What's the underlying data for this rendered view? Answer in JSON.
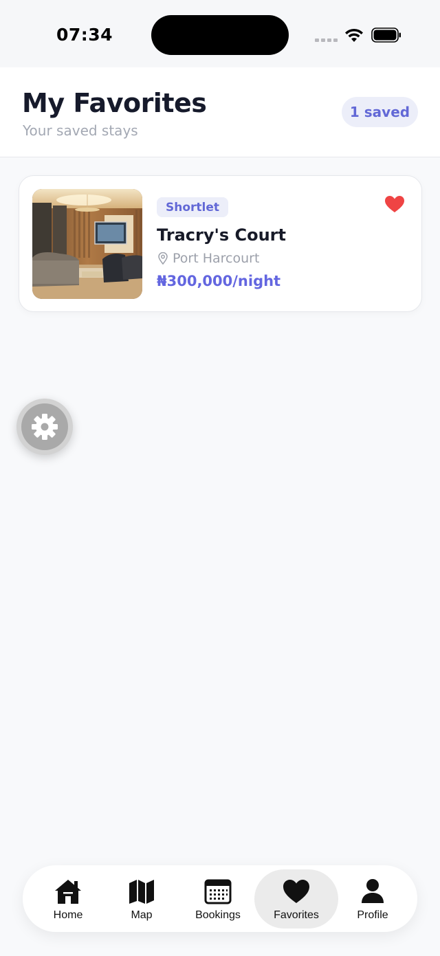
{
  "status_bar": {
    "time": "07:34"
  },
  "header": {
    "title": "My Favorites",
    "subtitle": "Your saved stays",
    "saved_count": "1 saved"
  },
  "favorites": [
    {
      "type": "Shortlet",
      "name": "Tracry's Court",
      "location": "Port Harcourt",
      "price": "₦300,000/night",
      "favorited": true
    }
  ],
  "bottom_nav": {
    "items": [
      {
        "label": "Home",
        "icon": "home-icon",
        "active": false
      },
      {
        "label": "Map",
        "icon": "map-icon",
        "active": false
      },
      {
        "label": "Bookings",
        "icon": "calendar-icon",
        "active": false
      },
      {
        "label": "Favorites",
        "icon": "heart-icon",
        "active": true
      },
      {
        "label": "Profile",
        "icon": "person-icon",
        "active": false
      }
    ]
  },
  "colors": {
    "accent": "#6366e0",
    "heart": "#ef4444",
    "badge_bg": "#eceef9",
    "title": "#161a2b",
    "muted": "#a3a8b3"
  }
}
